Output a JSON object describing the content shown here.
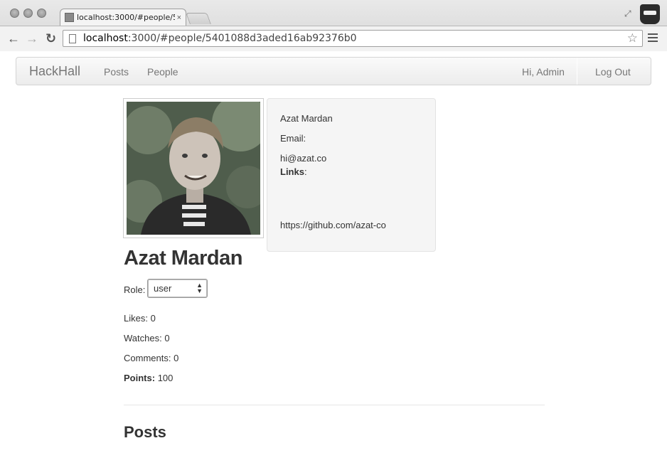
{
  "browser": {
    "tab_title": "localhost:3000/#people/5",
    "tab_close": "×",
    "url_host": "localhost",
    "url_rest": ":3000/#people/5401088d3aded16ab92376b0"
  },
  "navbar": {
    "brand": "HackHall",
    "links": [
      {
        "label": "Posts"
      },
      {
        "label": "People"
      }
    ],
    "greeting": "Hi, Admin",
    "logout": "Log Out"
  },
  "profile": {
    "card": {
      "name": "Azat Mardan",
      "email_label": "Email:",
      "email": "hi@azat.co",
      "links_label": "Links",
      "links_colon": ":",
      "link": "https://github.com/azat-co"
    },
    "name_heading": "Azat Mardan",
    "role_label": "Role:",
    "role_value": "user",
    "stats": {
      "likes_label": "Likes:",
      "likes": "0",
      "watches_label": "Watches:",
      "watches": "0",
      "comments_label": "Comments:",
      "comments": "0",
      "points_label": "Points:",
      "points": "100"
    }
  },
  "posts_heading": "Posts",
  "colors": {
    "navbar_bg": "#f2f2f2",
    "card_bg": "#f5f5f5",
    "text": "#333333"
  }
}
